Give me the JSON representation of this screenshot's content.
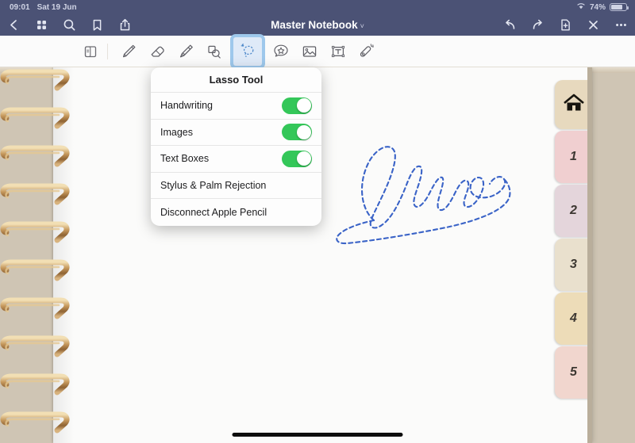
{
  "status_bar": {
    "time": "09:01",
    "date": "Sat 19 Jun",
    "battery_percent": "74%",
    "wifi_icon": "wifi-icon",
    "battery_icon": "battery-icon"
  },
  "top_bar": {
    "title": "Master Notebook",
    "title_chevron": "˅",
    "background_color": "#4b5275",
    "left_icons": [
      {
        "name": "back-chevron-icon",
        "label": "Back"
      },
      {
        "name": "grid-view-icon",
        "label": "Page Grid"
      },
      {
        "name": "search-icon",
        "label": "Search"
      },
      {
        "name": "bookmark-icon",
        "label": "Bookmark"
      },
      {
        "name": "share-icon",
        "label": "Share"
      }
    ],
    "right_icons": [
      {
        "name": "undo-icon",
        "label": "Undo"
      },
      {
        "name": "redo-icon",
        "label": "Redo"
      },
      {
        "name": "add-page-icon",
        "label": "Add Page"
      },
      {
        "name": "close-icon",
        "label": "Close"
      },
      {
        "name": "more-icon",
        "label": "More"
      }
    ]
  },
  "toolbar": {
    "background_color": "#fbfbfb",
    "active_tool": "lasso-tool",
    "active_highlight_color": "#9ec8ec",
    "tools": [
      {
        "name": "page-view-tool",
        "label": "Page View",
        "active": false
      },
      {
        "name": "pen-tool",
        "label": "Pen",
        "active": false
      },
      {
        "name": "eraser-tool",
        "label": "Eraser",
        "active": false
      },
      {
        "name": "highlighter-tool",
        "label": "Highlighter",
        "active": false
      },
      {
        "name": "shapes-tool",
        "label": "Shapes",
        "active": false
      },
      {
        "name": "lasso-tool",
        "label": "Lasso",
        "active": true
      },
      {
        "name": "sticker-tool",
        "label": "Sticker",
        "active": false
      },
      {
        "name": "image-tool",
        "label": "Image",
        "active": false
      },
      {
        "name": "text-box-tool",
        "label": "Text Box",
        "active": false
      },
      {
        "name": "laser-pointer-tool",
        "label": "Laser Pointer",
        "active": false
      }
    ],
    "stroke_preview": {
      "name": "dashed-stroke-preview",
      "style": "dashed-oval"
    }
  },
  "popover": {
    "title": "Lasso Tool",
    "rows": [
      {
        "label": "Handwriting",
        "type": "toggle",
        "value": "on",
        "name": "lasso-handwriting-toggle"
      },
      {
        "label": "Images",
        "type": "toggle",
        "value": "on",
        "name": "lasso-images-toggle"
      },
      {
        "label": "Text Boxes",
        "type": "toggle",
        "value": "on",
        "name": "lasso-text-boxes-toggle"
      },
      {
        "label": "Stylus & Palm Rejection",
        "type": "action",
        "value": "",
        "name": "stylus-palm-rejection-row"
      },
      {
        "label": "Disconnect Apple Pencil",
        "type": "action",
        "value": "",
        "name": "disconnect-apple-pencil-row"
      }
    ],
    "toggle_on_color": "#34c759"
  },
  "canvas": {
    "page_background": "#fbfbfa",
    "desk_background": "#cfc5b4",
    "lasso_selection": {
      "name": "lasso-selection-path",
      "word": "lasso",
      "stroke_color": "#3a63c7",
      "style": "dashed"
    }
  },
  "tab_strip": {
    "tabs": [
      {
        "label": "",
        "icon": "home-icon",
        "color": "#e7d9be",
        "name": "tab-home"
      },
      {
        "label": "1",
        "icon": "",
        "color": "#f0cfd0",
        "name": "tab-1"
      },
      {
        "label": "2",
        "icon": "",
        "color": "#e4d5db",
        "name": "tab-2"
      },
      {
        "label": "3",
        "icon": "",
        "color": "#e9e0cd",
        "name": "tab-3"
      },
      {
        "label": "4",
        "icon": "",
        "color": "#eddcb8",
        "name": "tab-4"
      },
      {
        "label": "5",
        "icon": "",
        "color": "#f1d6ce",
        "name": "tab-5"
      }
    ]
  },
  "home_indicator": {
    "name": "home-indicator"
  }
}
